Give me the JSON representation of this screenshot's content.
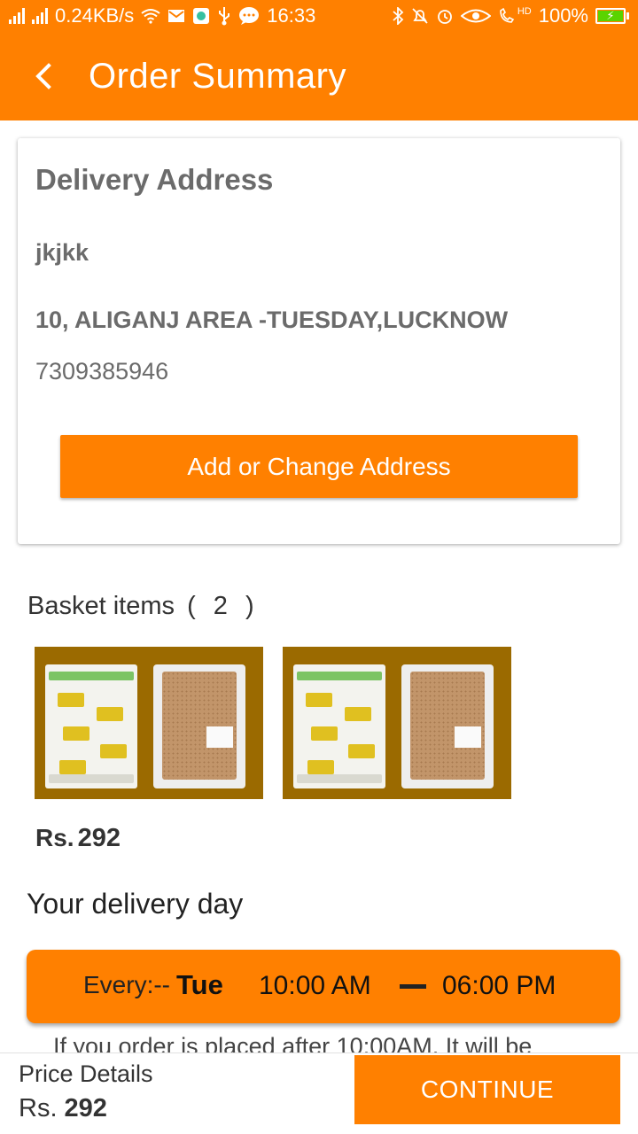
{
  "status_bar": {
    "network_speed": "0.24KB/s",
    "time": "16:33",
    "hd_label": "HD",
    "battery": "100%",
    "icons": [
      "signal-icon",
      "signal-icon",
      "wifi-icon",
      "mail-icon",
      "app-icon",
      "usb-icon",
      "chat-icon",
      "bluetooth-icon",
      "bell-off-icon",
      "alarm-icon",
      "eye-icon",
      "hd-call-icon",
      "battery-icon"
    ]
  },
  "app_bar": {
    "title": "Order Summary",
    "back_icon": "chevron-left-icon"
  },
  "address": {
    "heading": "Delivery Address",
    "name": "jkjkk",
    "line": "10, ALIGANJ AREA -TUESDAY,LUCKNOW",
    "phone": "7309385946",
    "button_label": "Add or Change Address"
  },
  "basket": {
    "heading": "Basket items",
    "count": "( 2 )",
    "price_currency": "Rs.",
    "price_amount": "292"
  },
  "delivery": {
    "heading": "Your delivery day",
    "every_label": "Every:--",
    "day": "Tue",
    "start_time": "10:00 AM",
    "end_time": "06:00 PM",
    "note": "If you order is placed after 10:00AM, It will be"
  },
  "bottom_bar": {
    "price_details_label": "Price Details",
    "currency": "Rs.",
    "amount": "292",
    "continue_label": "CONTINUE"
  },
  "colors": {
    "accent": "#ff8000",
    "text_grey": "#6b6b6b",
    "battery_green": "#5ad400"
  }
}
